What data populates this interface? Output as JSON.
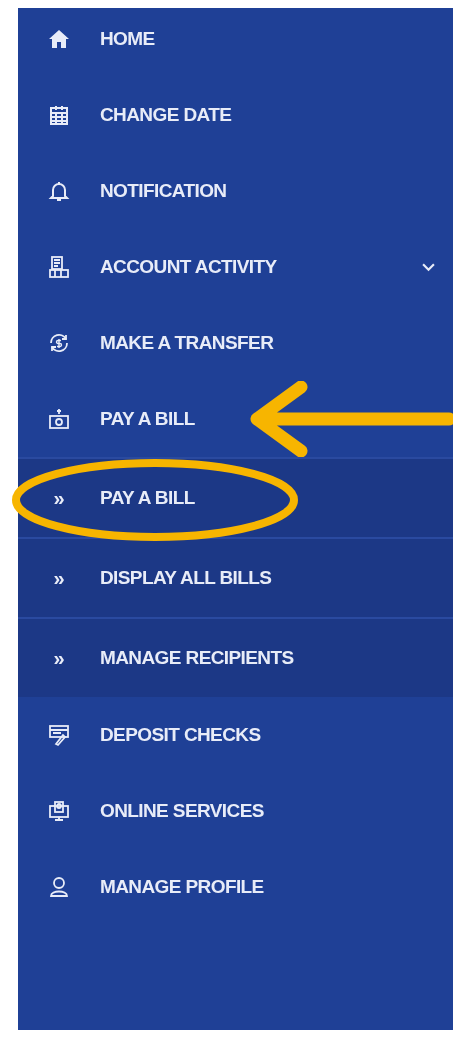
{
  "sidebar": {
    "items": [
      {
        "label": "HOME",
        "kind": "link"
      },
      {
        "label": "CHANGE DATE",
        "kind": "link"
      },
      {
        "label": "NOTIFICATION",
        "kind": "link"
      },
      {
        "label": "ACCOUNT ACTIVITY",
        "kind": "dropdown"
      },
      {
        "label": "MAKE A TRANSFER",
        "kind": "link"
      },
      {
        "label": "PAY A BILL",
        "kind": "link",
        "children": [
          {
            "label": "PAY A BILL",
            "marker": "»"
          },
          {
            "label": "DISPLAY ALL BILLS",
            "marker": "»"
          },
          {
            "label": "MANAGE RECIPIENTS",
            "marker": "»"
          }
        ]
      },
      {
        "label": "DEPOSIT CHECKS",
        "kind": "link"
      },
      {
        "label": "ONLINE SERVICES",
        "kind": "link"
      },
      {
        "label": "MANAGE PROFILE",
        "kind": "link"
      }
    ]
  }
}
